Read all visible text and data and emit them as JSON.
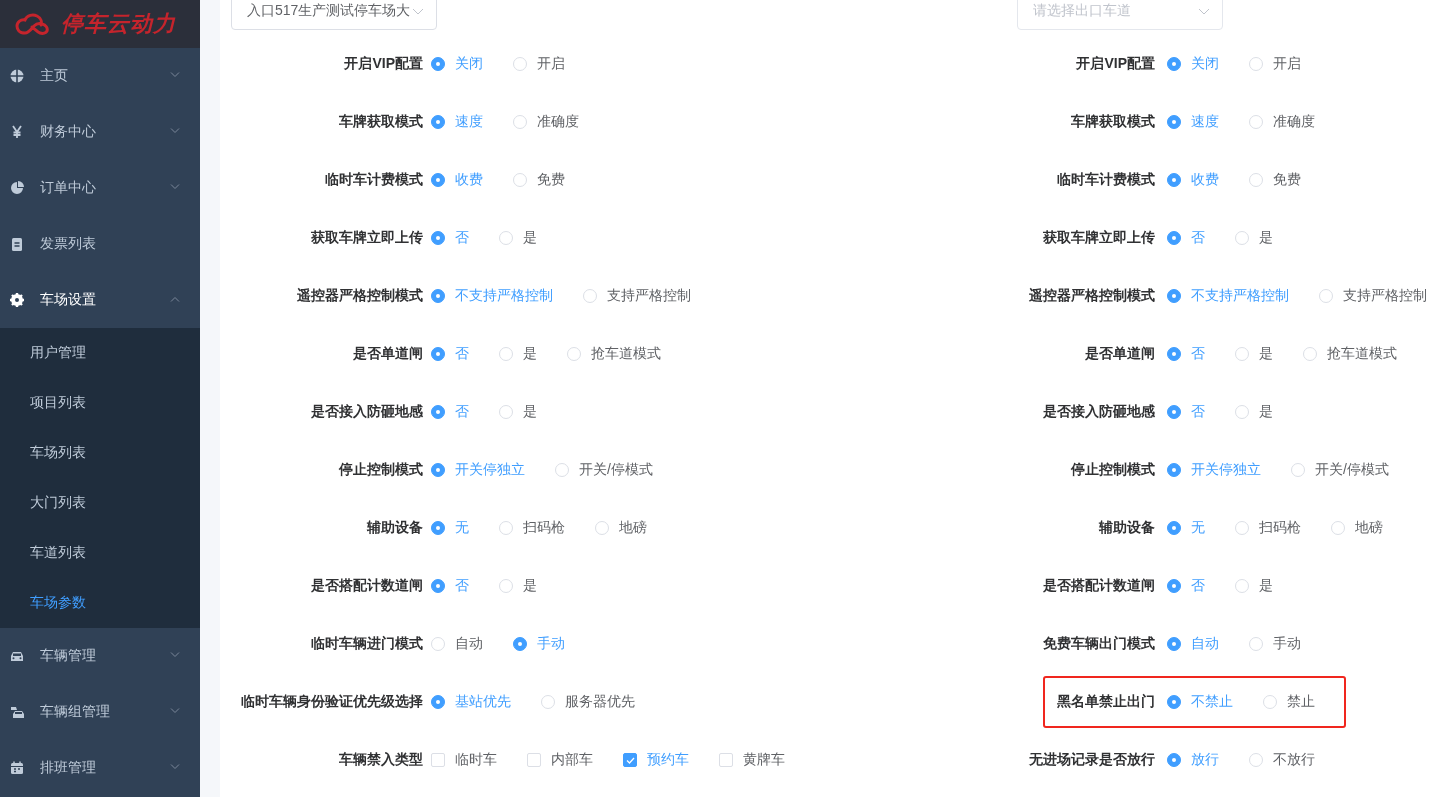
{
  "sidebar": {
    "logo": "停车云动力",
    "items": [
      {
        "label": "主页",
        "kind": "submenu",
        "expanded": false,
        "selected": false
      },
      {
        "label": "财务中心",
        "kind": "submenu",
        "expanded": false,
        "selected": false
      },
      {
        "label": "订单中心",
        "kind": "submenu",
        "expanded": false,
        "selected": false
      },
      {
        "label": "发票列表",
        "kind": "link",
        "selected": false
      },
      {
        "label": "车场设置",
        "kind": "submenu",
        "expanded": true,
        "selected": false,
        "children": [
          {
            "label": "用户管理",
            "selected": false
          },
          {
            "label": "项目列表",
            "selected": false
          },
          {
            "label": "车场列表",
            "selected": false
          },
          {
            "label": "大门列表",
            "selected": false
          },
          {
            "label": "车道列表",
            "selected": false
          },
          {
            "label": "车场参数",
            "selected": true
          }
        ]
      },
      {
        "label": "车辆管理",
        "kind": "submenu",
        "expanded": false,
        "selected": false
      },
      {
        "label": "车辆组管理",
        "kind": "submenu",
        "expanded": false,
        "selected": false
      },
      {
        "label": "排班管理",
        "kind": "submenu",
        "expanded": false,
        "selected": false
      }
    ]
  },
  "forms": [
    {
      "select": {
        "value": "入口517生产测试停车场大"
      },
      "rows": [
        {
          "label": "开启VIP配置",
          "kind": "radio",
          "options": [
            {
              "label": "关闭",
              "selected": true
            },
            {
              "label": "开启",
              "selected": false
            }
          ]
        },
        {
          "label": "车牌获取模式",
          "kind": "radio",
          "options": [
            {
              "label": "速度",
              "selected": true
            },
            {
              "label": "准确度",
              "selected": false
            }
          ]
        },
        {
          "label": "临时车计费模式",
          "kind": "radio",
          "options": [
            {
              "label": "收费",
              "selected": true
            },
            {
              "label": "免费",
              "selected": false
            }
          ]
        },
        {
          "label": "获取车牌立即上传",
          "kind": "radio",
          "options": [
            {
              "label": "否",
              "selected": true
            },
            {
              "label": "是",
              "selected": false
            }
          ]
        },
        {
          "label": "遥控器严格控制模式",
          "kind": "radio",
          "options": [
            {
              "label": "不支持严格控制",
              "selected": true
            },
            {
              "label": "支持严格控制",
              "selected": false
            }
          ]
        },
        {
          "label": "是否单道闸",
          "kind": "radio",
          "options": [
            {
              "label": "否",
              "selected": true
            },
            {
              "label": "是",
              "selected": false
            },
            {
              "label": "抢车道模式",
              "selected": false
            }
          ]
        },
        {
          "label": "是否接入防砸地感",
          "kind": "radio",
          "options": [
            {
              "label": "否",
              "selected": true
            },
            {
              "label": "是",
              "selected": false
            }
          ]
        },
        {
          "label": "停止控制模式",
          "kind": "radio",
          "options": [
            {
              "label": "开关停独立",
              "selected": true
            },
            {
              "label": "开关/停模式",
              "selected": false
            }
          ]
        },
        {
          "label": "辅助设备",
          "kind": "radio",
          "options": [
            {
              "label": "无",
              "selected": true
            },
            {
              "label": "扫码枪",
              "selected": false
            },
            {
              "label": "地磅",
              "selected": false
            }
          ]
        },
        {
          "label": "是否搭配计数道闸",
          "kind": "radio",
          "options": [
            {
              "label": "否",
              "selected": true
            },
            {
              "label": "是",
              "selected": false
            }
          ]
        },
        {
          "label": "临时车辆进门模式",
          "kind": "radio",
          "options": [
            {
              "label": "自动",
              "selected": false
            },
            {
              "label": "手动",
              "selected": true
            }
          ]
        },
        {
          "label": "临时车辆身份验证优先级选择",
          "kind": "radio",
          "options": [
            {
              "label": "基站优先",
              "selected": true
            },
            {
              "label": "服务器优先",
              "selected": false
            }
          ]
        },
        {
          "label": "车辆禁入类型",
          "kind": "checkbox",
          "options": [
            {
              "label": "临时车",
              "checked": false
            },
            {
              "label": "内部车",
              "checked": false
            },
            {
              "label": "预约车",
              "checked": true
            },
            {
              "label": "黄牌车",
              "checked": false
            }
          ]
        }
      ]
    },
    {
      "select": {
        "placeholder": "请选择出口车道"
      },
      "rows": [
        {
          "label": "开启VIP配置",
          "kind": "radio",
          "options": [
            {
              "label": "关闭",
              "selected": true
            },
            {
              "label": "开启",
              "selected": false
            }
          ]
        },
        {
          "label": "车牌获取模式",
          "kind": "radio",
          "options": [
            {
              "label": "速度",
              "selected": true
            },
            {
              "label": "准确度",
              "selected": false
            }
          ]
        },
        {
          "label": "临时车计费模式",
          "kind": "radio",
          "options": [
            {
              "label": "收费",
              "selected": true
            },
            {
              "label": "免费",
              "selected": false
            }
          ]
        },
        {
          "label": "获取车牌立即上传",
          "kind": "radio",
          "options": [
            {
              "label": "否",
              "selected": true
            },
            {
              "label": "是",
              "selected": false
            }
          ]
        },
        {
          "label": "遥控器严格控制模式",
          "kind": "radio",
          "options": [
            {
              "label": "不支持严格控制",
              "selected": true
            },
            {
              "label": "支持严格控制",
              "selected": false
            }
          ]
        },
        {
          "label": "是否单道闸",
          "kind": "radio",
          "options": [
            {
              "label": "否",
              "selected": true
            },
            {
              "label": "是",
              "selected": false
            },
            {
              "label": "抢车道模式",
              "selected": false
            }
          ]
        },
        {
          "label": "是否接入防砸地感",
          "kind": "radio",
          "options": [
            {
              "label": "否",
              "selected": true
            },
            {
              "label": "是",
              "selected": false
            }
          ]
        },
        {
          "label": "停止控制模式",
          "kind": "radio",
          "options": [
            {
              "label": "开关停独立",
              "selected": true
            },
            {
              "label": "开关/停模式",
              "selected": false
            }
          ]
        },
        {
          "label": "辅助设备",
          "kind": "radio",
          "options": [
            {
              "label": "无",
              "selected": true
            },
            {
              "label": "扫码枪",
              "selected": false
            },
            {
              "label": "地磅",
              "selected": false
            }
          ]
        },
        {
          "label": "是否搭配计数道闸",
          "kind": "radio",
          "options": [
            {
              "label": "否",
              "selected": true
            },
            {
              "label": "是",
              "selected": false
            }
          ]
        },
        {
          "label": "免费车辆出门模式",
          "kind": "radio",
          "options": [
            {
              "label": "自动",
              "selected": true
            },
            {
              "label": "手动",
              "selected": false
            }
          ]
        },
        {
          "label": "黑名单禁止出门",
          "kind": "radio",
          "highlighted": true,
          "options": [
            {
              "label": "不禁止",
              "selected": true
            },
            {
              "label": "禁止",
              "selected": false
            }
          ]
        },
        {
          "label": "无进场记录是否放行",
          "kind": "radio",
          "options": [
            {
              "label": "放行",
              "selected": true
            },
            {
              "label": "不放行",
              "selected": false
            }
          ]
        }
      ]
    }
  ]
}
